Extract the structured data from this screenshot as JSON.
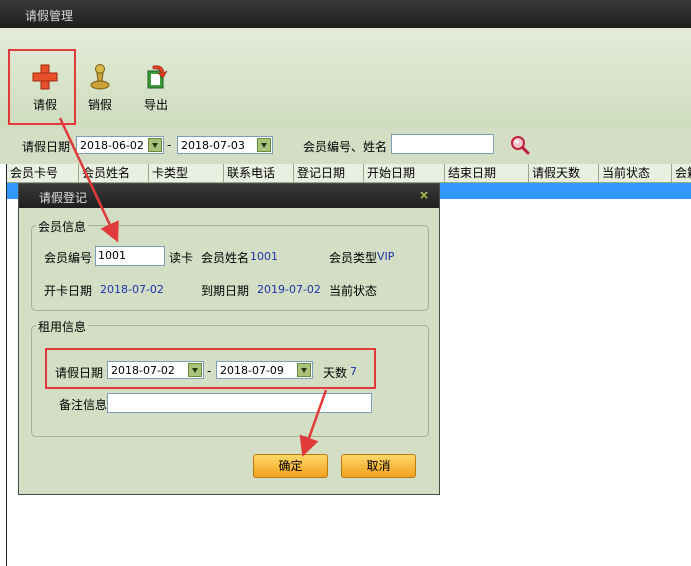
{
  "window": {
    "title": "请假管理"
  },
  "toolbar": {
    "leave_label": "请假",
    "cancel_leave_label": "销假",
    "export_label": "导出",
    "leave_icon": "plus-icon",
    "cancel_leave_icon": "pawn-icon",
    "export_icon": "export-icon"
  },
  "filter": {
    "date_label": "请假日期",
    "date_from": "2018-06-02",
    "date_sep": "-",
    "date_to": "2018-07-03",
    "member_label": "会员编号、姓名",
    "member_value": "",
    "search_icon": "search-icon"
  },
  "grid": {
    "columns": [
      "会员卡号",
      "会员姓名",
      "卡类型",
      "联系电话",
      "登记日期",
      "开始日期",
      "结束日期",
      "请假天数",
      "当前状态",
      "会籍"
    ]
  },
  "dialog": {
    "title": "请假登记",
    "close_symbol": "×",
    "member_group_label": "会员信息",
    "member_no_label": "会员编号",
    "member_no_value": "1001",
    "read_card_label": "读卡",
    "member_name_label": "会员姓名",
    "member_name_value": "1001",
    "member_type_label": "会员类型",
    "member_type_value": "VIP",
    "open_date_label": "开卡日期",
    "open_date_value": "2018-07-02",
    "expire_date_label": "到期日期",
    "expire_date_value": "2019-07-02",
    "status_label": "当前状态",
    "status_value": "",
    "rental_group_label": "租用信息",
    "leave_date_label": "请假日期",
    "leave_from": "2018-07-02",
    "leave_sep": "-",
    "leave_to": "2018-07-09",
    "days_label": "天数",
    "days_value": "7",
    "remark_label": "备注信息",
    "remark_value": "",
    "ok_label": "确定",
    "cancel_label": "取消"
  },
  "colors": {
    "accent_red": "#e03a3a",
    "selected_row": "#3399ff",
    "button_orange": "#f0a01e",
    "panel_green": "#d3dec5"
  }
}
